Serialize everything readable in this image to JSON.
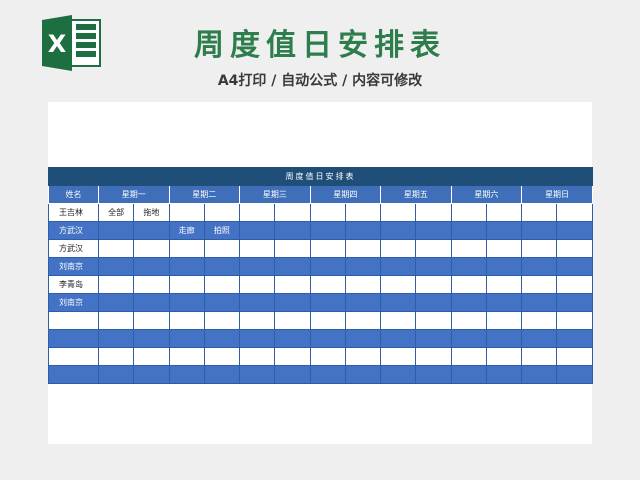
{
  "header": {
    "title": "周度值日安排表",
    "subtitle": "A4打印 / 自动公式 / 内容可修改",
    "logo_icon": "excel-logo-icon",
    "logo_letter": "X"
  },
  "table": {
    "title": "周度值日安排表",
    "name_header": "姓名",
    "days": [
      "星期一",
      "星期二",
      "星期三",
      "星期四",
      "星期五",
      "星期六",
      "星期日"
    ],
    "rows": [
      {
        "name": "王吉林",
        "cells": [
          "全部",
          "拖地",
          "",
          "",
          "",
          "",
          "",
          "",
          "",
          "",
          "",
          "",
          "",
          ""
        ]
      },
      {
        "name": "方武汉",
        "cells": [
          "",
          "",
          "走廊",
          "拍照",
          "",
          "",
          "",
          "",
          "",
          "",
          "",
          "",
          "",
          ""
        ]
      },
      {
        "name": "方武汉",
        "cells": [
          "",
          "",
          "",
          "",
          "",
          "",
          "",
          "",
          "",
          "",
          "",
          "",
          "",
          ""
        ]
      },
      {
        "name": "刘南京",
        "cells": [
          "",
          "",
          "",
          "",
          "",
          "",
          "",
          "",
          "",
          "",
          "",
          "",
          "",
          ""
        ]
      },
      {
        "name": "李青岛",
        "cells": [
          "",
          "",
          "",
          "",
          "",
          "",
          "",
          "",
          "",
          "",
          "",
          "",
          "",
          ""
        ]
      },
      {
        "name": "刘南京",
        "cells": [
          "",
          "",
          "",
          "",
          "",
          "",
          "",
          "",
          "",
          "",
          "",
          "",
          "",
          ""
        ]
      },
      {
        "name": "",
        "cells": [
          "",
          "",
          "",
          "",
          "",
          "",
          "",
          "",
          "",
          "",
          "",
          "",
          "",
          ""
        ]
      },
      {
        "name": "",
        "cells": [
          "",
          "",
          "",
          "",
          "",
          "",
          "",
          "",
          "",
          "",
          "",
          "",
          "",
          ""
        ]
      },
      {
        "name": "",
        "cells": [
          "",
          "",
          "",
          "",
          "",
          "",
          "",
          "",
          "",
          "",
          "",
          "",
          "",
          ""
        ]
      },
      {
        "name": "",
        "cells": [
          "",
          "",
          "",
          "",
          "",
          "",
          "",
          "",
          "",
          "",
          "",
          "",
          "",
          ""
        ]
      }
    ]
  },
  "colors": {
    "title_green": "#2e7d4c",
    "table_title_bg": "#1f4e79",
    "header_bg": "#3e6fb8",
    "row_blue": "#4472c4",
    "excel_green": "#1d6f42"
  }
}
